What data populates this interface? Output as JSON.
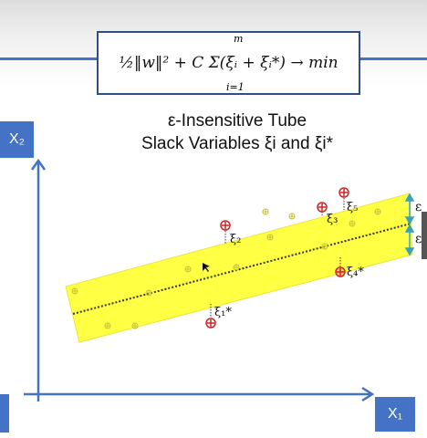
{
  "formula": {
    "objective": "½‖w‖² + C Σ(ξᵢ + ξᵢ*) → min",
    "sum_upper": "m",
    "sum_lower": "i=1"
  },
  "title": {
    "line1": "ε-Insensitive Tube",
    "line2": "Slack Variables ξi and ξi*"
  },
  "axes": {
    "y_label": "X₂",
    "x_label": "X₁"
  },
  "annotations": {
    "epsilon_upper": "ε",
    "epsilon_lower": "ε",
    "xi_2": "ξ₂",
    "xi_3": "ξ₃",
    "xi_5": "ξ₅",
    "xi_4": "ξ₄*",
    "xi_1": "ξ₁*"
  },
  "colors": {
    "tube": "#ffff44",
    "accent": "#4472c4",
    "outlier": "#cc2222"
  }
}
